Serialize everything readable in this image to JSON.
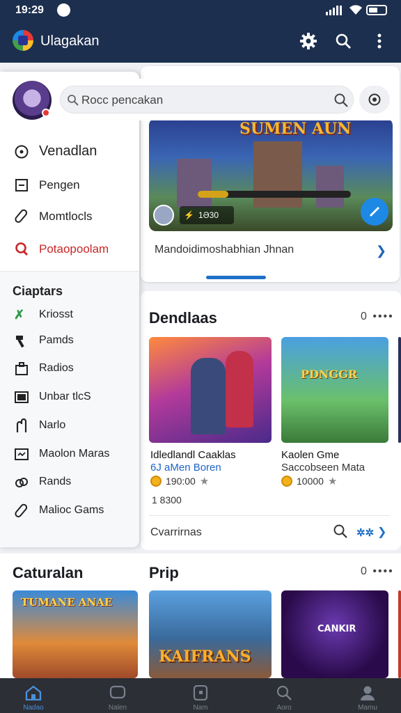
{
  "status": {
    "time": "19:29"
  },
  "app": {
    "title": "Ulagakan"
  },
  "search": {
    "placeholder": "",
    "value": "Rocc pencakan"
  },
  "drawer": {
    "primary": [
      {
        "label": "Venadlan",
        "icon": "compass-icon",
        "color": "#222222"
      },
      {
        "label": "Pengen",
        "icon": "square-icon",
        "color": "#222222"
      },
      {
        "label": "Momtlocls",
        "icon": "paperclip-icon",
        "color": "#222222"
      },
      {
        "label": "Potaopoolam",
        "icon": "search-icon",
        "color": "#c62828"
      }
    ],
    "categories_title": "Ciaptars",
    "categories": [
      {
        "label": "Kriosst",
        "icon": "leaf-icon"
      },
      {
        "label": "Pamds",
        "icon": "hammer-icon"
      },
      {
        "label": "Radios",
        "icon": "bag-icon"
      },
      {
        "label": "Unbar  tlcS",
        "icon": "monitor-icon"
      },
      {
        "label": "Narlo",
        "icon": "fist-icon"
      },
      {
        "label": "Maolon Maras",
        "icon": "controller-icon"
      },
      {
        "label": "Rands",
        "icon": "link-icon"
      },
      {
        "label": "Malioc Gams",
        "icon": "paperclip-icon"
      }
    ]
  },
  "hero": {
    "logo_text": "SUMEN AUN",
    "chip_text": "1Ə30",
    "progress": 0.2,
    "caption": "Mandoidimoshabhian Jhnan"
  },
  "section": {
    "title": "Dendlaas",
    "more": "0 ••••",
    "tiles": [
      {
        "name": "Idledlandl Caaklas",
        "sub": "6J aMen Boren",
        "sub_color": "#1e64c8",
        "rating": "190:00"
      },
      {
        "name": "Kaolen Gme",
        "sub": "Saccobseen Mata",
        "sub_color": "#333333",
        "rating": "10000"
      }
    ],
    "tile2_logo": "PDNGGR",
    "extra": "1 8300",
    "footer": "Cvarrirnas"
  },
  "lower": {
    "left_title": "Caturalan",
    "right_title": "Prip",
    "more": "0 ••••",
    "banner_texts": [
      "TUMANE ANAE",
      "KAIFRANS",
      "CANKIR"
    ]
  },
  "nav": [
    {
      "label": "Nadao",
      "icon": "home-icon"
    },
    {
      "label": "Nalen",
      "icon": "chat-icon"
    },
    {
      "label": "Nam",
      "icon": "square-icon"
    },
    {
      "label": "Aoro",
      "icon": "search-icon"
    },
    {
      "label": "Mamu",
      "icon": "user-icon"
    }
  ],
  "colors": {
    "appbar": "#1c2f4f",
    "accent": "#1e70c8",
    "nav_active": "#4a8fd8"
  }
}
